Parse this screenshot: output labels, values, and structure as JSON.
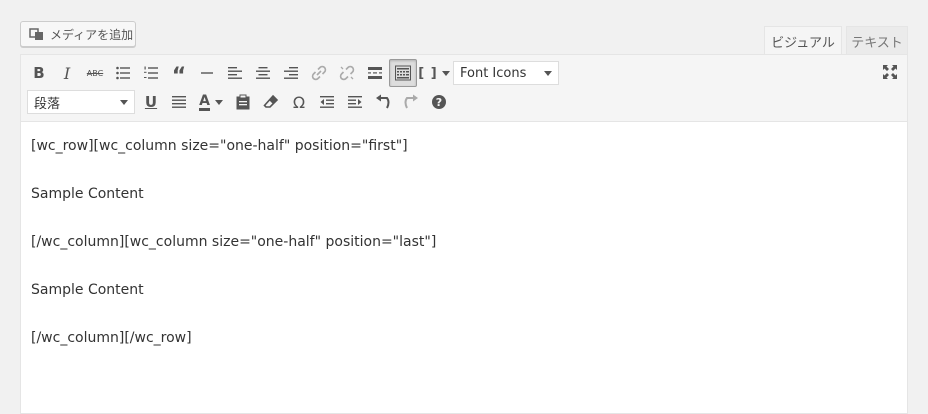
{
  "media": {
    "label": "メディアを追加"
  },
  "tabs": {
    "visual": "ビジュアル",
    "text": "テキスト"
  },
  "toolbar": {
    "format_select": "段落",
    "font_icons_select": "Font Icons",
    "shortcode_label": "[ ]"
  },
  "content": {
    "lines": [
      "[wc_row][wc_column size=\"one-half\" position=\"first\"]",
      "Sample Content",
      "[/wc_column][wc_column size=\"one-half\" position=\"last\"]",
      "Sample Content",
      "[/wc_column][/wc_row]"
    ]
  }
}
